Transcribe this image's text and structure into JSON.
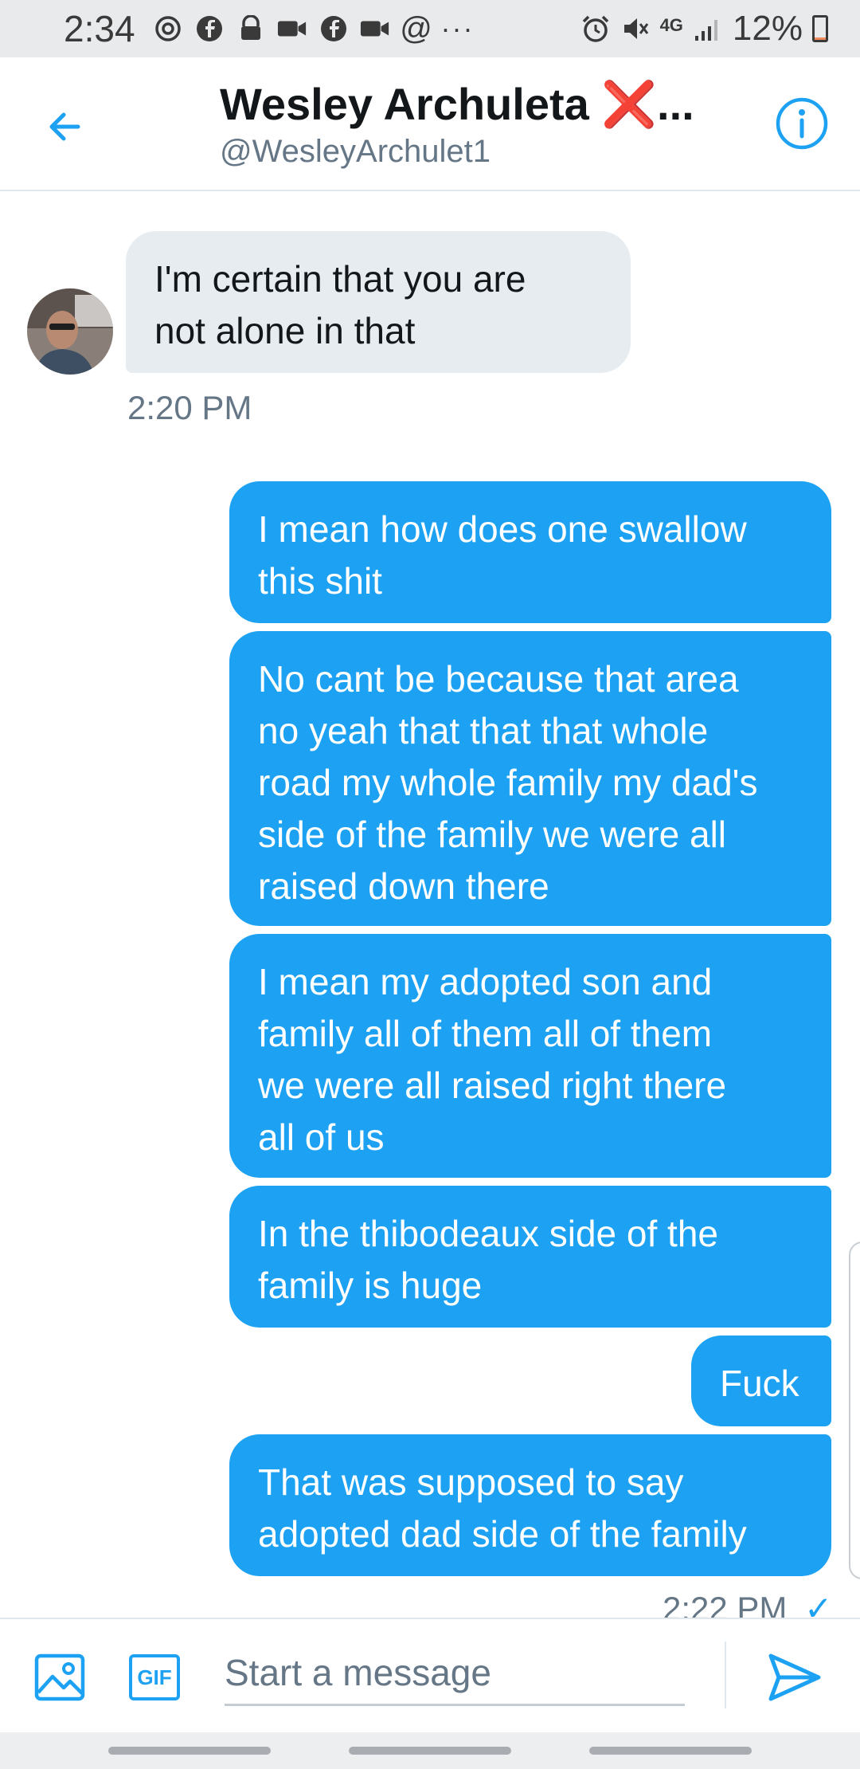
{
  "status_bar": {
    "time": "2:34",
    "battery": "12%",
    "network": "4G",
    "icons": [
      "instagram-icon",
      "facebook-icon",
      "lock-icon",
      "video-icon",
      "facebook-icon",
      "video-icon",
      "at-icon",
      "more-icon",
      "alarm-icon",
      "mute-icon",
      "signal-icon",
      "battery-icon"
    ]
  },
  "header": {
    "name": "Wesley Archuleta",
    "emoji": "❌",
    "ellipsis": "...",
    "handle": "@WesleyArchulet1"
  },
  "messages": [
    {
      "from": "them",
      "text_lines": [
        "I'm certain that you are",
        "not alone in that"
      ]
    },
    {
      "from": "me",
      "text_lines": [
        "I mean how does one swallow",
        "this shit"
      ]
    },
    {
      "from": "me",
      "text_lines": [
        "No cant be because that area",
        "no yeah that that that whole",
        "road my whole family my dad's",
        "side of the family we were all",
        "raised down there"
      ]
    },
    {
      "from": "me",
      "text_lines": [
        "I mean my adopted son and",
        "family all of them all of them",
        "we were all raised right there",
        "all of us"
      ]
    },
    {
      "from": "me",
      "text_lines": [
        "In the thibodeaux side of the",
        "family is huge"
      ]
    },
    {
      "from": "me",
      "text_lines": [
        "Fuck"
      ]
    },
    {
      "from": "me",
      "text_lines": [
        "That was supposed to say",
        "adopted dad side of the family"
      ]
    }
  ],
  "timestamps": {
    "received": "2:20 PM",
    "sent": "2:22 PM",
    "sent_check": "✓"
  },
  "composer": {
    "placeholder": "Start a message",
    "gif_label": "GIF"
  },
  "colors": {
    "accent": "#1da1f2",
    "received_bubble": "#e6ecf0",
    "muted_text": "#657786"
  }
}
